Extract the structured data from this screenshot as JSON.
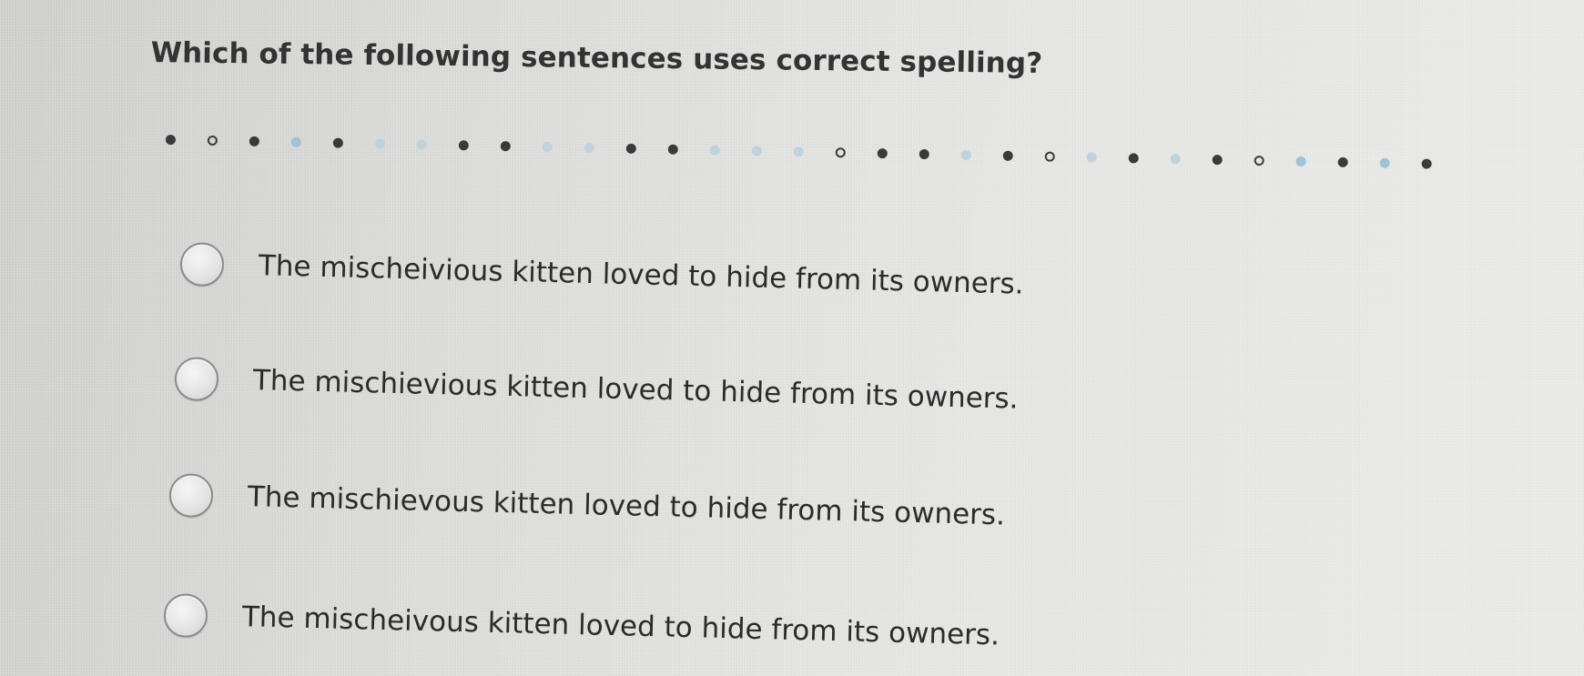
{
  "question": {
    "text": "Which of the following sentences uses correct spelling?"
  },
  "options": [
    {
      "label": "The mischeivious kitten loved to hide from its owners."
    },
    {
      "label": "The mischievious kitten loved to hide from its owners."
    },
    {
      "label": "The mischievous kitten loved to hide from its owners."
    },
    {
      "label": "The mischeivous kitten loved to hide from its owners."
    }
  ],
  "colors": {
    "text": "#333333",
    "radio_border": "#8c8c8c",
    "dot_dark": "#3a3a3a",
    "dot_blue": "#9fc3d8"
  }
}
